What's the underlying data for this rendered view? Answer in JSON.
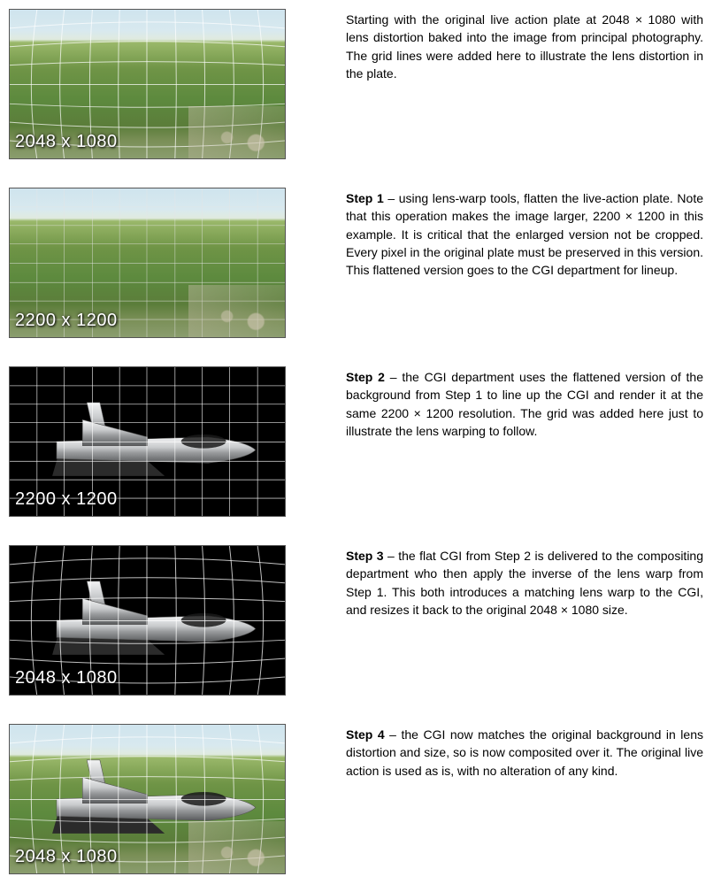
{
  "rows": [
    {
      "resolution": "2048 x 1080",
      "step_label": "",
      "text": "Starting with the original live action plate at 2048 × 1080 with lens distortion baked into the image from principal photography. The grid lines were added here to illustrate the lens distortion in the plate.",
      "image_type": "aerial",
      "grid": "barrel"
    },
    {
      "resolution": "2200 x 1200",
      "step_label": "Step 1",
      "text": " – using lens-warp tools, flatten the live-action plate. Note that this operation makes the image larger, 2200 × 1200 in this example. It is critical that the enlarged version not be cropped. Every pixel in the original plate must be preserved in this version. This flattened version goes to the CGI department for lineup.",
      "image_type": "aerial",
      "grid": "flat"
    },
    {
      "resolution": "2200 x 1200",
      "step_label": "Step 2",
      "text": " – the CGI department uses the flattened version of the background from Step 1 to line up the CGI and render it at the same 2200 × 1200 resolution. The grid was added here just to illustrate the lens warping to follow.",
      "image_type": "jet_black",
      "grid": "flat"
    },
    {
      "resolution": "2048 x 1080",
      "step_label": "Step 3",
      "text": " – the flat CGI from Step 2 is delivered to the compositing department who then apply the inverse of the lens warp from Step 1. This both introduces a matching lens warp to the CGI, and resizes it back to the original 2048 × 1080 size.",
      "image_type": "jet_black",
      "grid": "barrel"
    },
    {
      "resolution": "2048 x 1080",
      "step_label": "Step 4",
      "text": " – the CGI now matches the original background in lens distortion and size, so is now composited over it. The original live action is used as is, with no alteration of any kind.",
      "image_type": "jet_aerial",
      "grid": "barrel"
    }
  ]
}
